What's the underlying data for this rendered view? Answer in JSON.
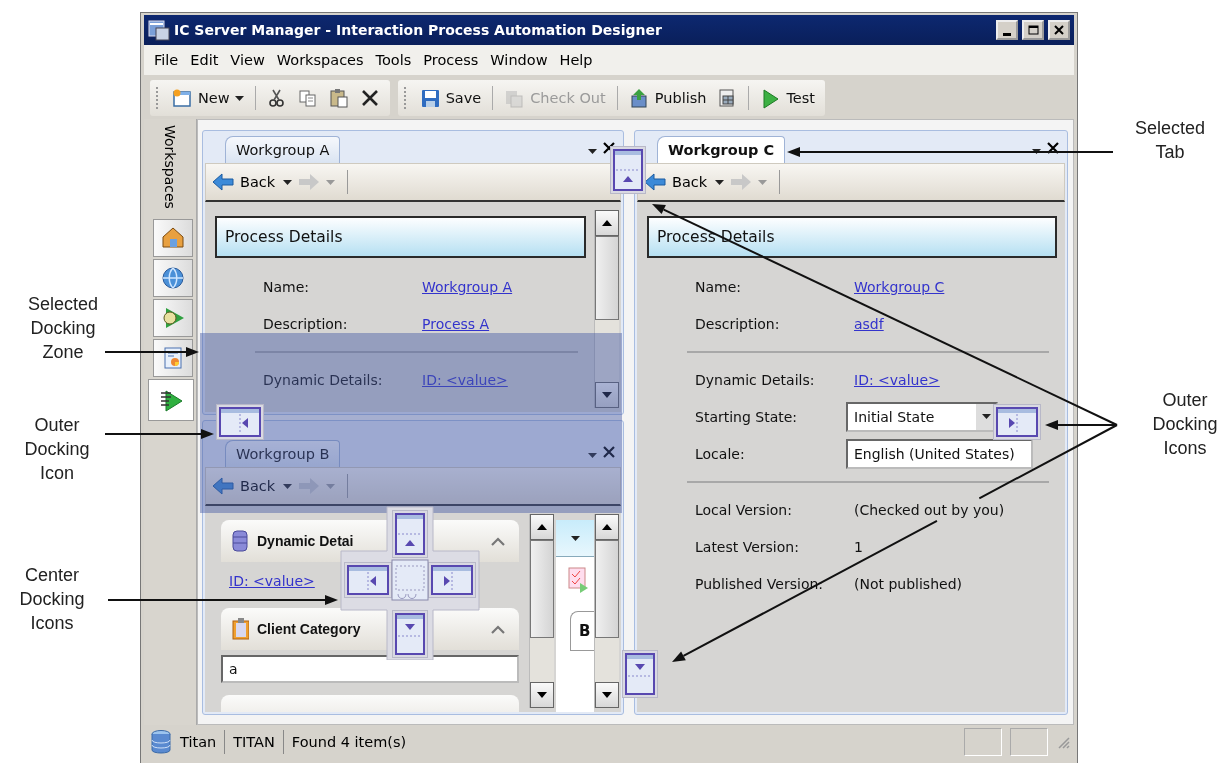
{
  "window": {
    "title": "IC Server Manager - Interaction Process Automation Designer"
  },
  "menu": [
    "File",
    "Edit",
    "View",
    "Workspaces",
    "Tools",
    "Process",
    "Window",
    "Help"
  ],
  "toolbar": [
    {
      "label": "New",
      "disabled": false
    },
    {
      "label": "Save",
      "disabled": false
    },
    {
      "label": "Check Out",
      "disabled": true
    },
    {
      "label": "Publish",
      "disabled": false
    },
    {
      "label": "Test",
      "disabled": false
    }
  ],
  "workspaces": {
    "title": "Workspaces",
    "items": [
      {
        "selected": false
      },
      {
        "selected": false
      },
      {
        "selected": false
      },
      {
        "selected": false
      },
      {
        "selected": true
      }
    ]
  },
  "panels": [
    {
      "tab": "Workgroup A",
      "selected": false,
      "back": "Back",
      "section": "Process Details",
      "fields": [
        {
          "kind": "link",
          "label": "Name:",
          "value": "Workgroup A"
        },
        {
          "kind": "link",
          "label": "Description:",
          "value": "Process A"
        },
        {
          "kind": "divider"
        },
        {
          "kind": "link",
          "label": "Dynamic Details:",
          "value": "ID: <value>"
        }
      ]
    },
    {
      "tab": "Workgroup B",
      "selected": false,
      "back": "Back",
      "groups": [
        {
          "title": "Dynamic Detai",
          "expanded": true,
          "kind": "link",
          "value": "ID: <value>"
        },
        {
          "title": "Client Category",
          "expanded": true,
          "kind": "input",
          "value": "a"
        }
      ],
      "side_tab": "B"
    },
    {
      "tab": "Workgroup C",
      "selected": true,
      "back": "Back",
      "section": "Process Details",
      "fields": [
        {
          "kind": "link",
          "label": "Name:",
          "value": "Workgroup C"
        },
        {
          "kind": "link",
          "label": "Description:",
          "value": "asdf"
        },
        {
          "kind": "divider"
        },
        {
          "kind": "link",
          "label": "Dynamic Details:",
          "value": "ID: <value>"
        },
        {
          "kind": "combo",
          "label": "Starting State:",
          "value": "Initial State"
        },
        {
          "kind": "input",
          "label": "Locale:",
          "value": "English (United States)"
        },
        {
          "kind": "divider"
        },
        {
          "kind": "text",
          "label": "Local Version:",
          "value": "(Checked out by you)"
        },
        {
          "kind": "text",
          "label": "Latest Version:",
          "value": "1"
        },
        {
          "kind": "text",
          "label": "Published Version:",
          "value": "(Not published)"
        }
      ]
    }
  ],
  "status_bar": [
    "Titan",
    "TITAN",
    "Found 4 item(s)"
  ],
  "annotations": [
    "Selected Tab",
    "Selected Docking Zone",
    "Outer Docking Icon",
    "Center Docking Icons",
    "Outer Docking Icons"
  ]
}
